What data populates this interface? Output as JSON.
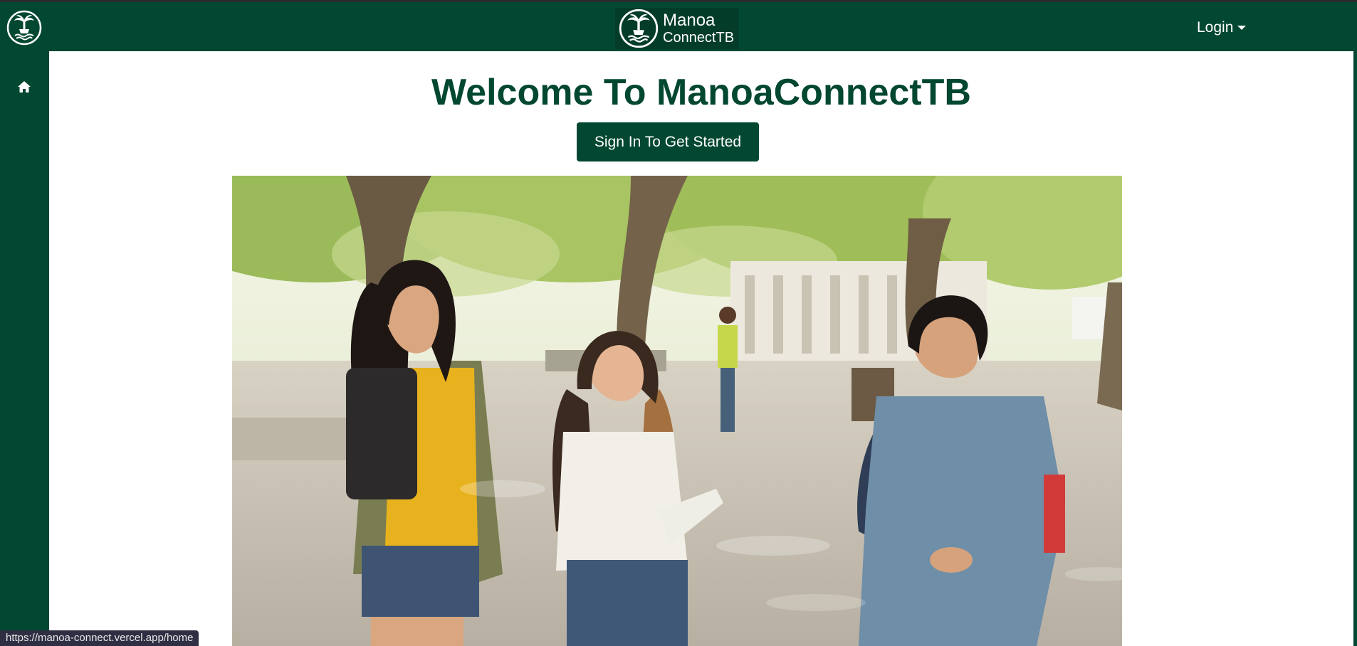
{
  "navbar": {
    "brand_line1": "Manoa",
    "brand_line2": "ConnectTB",
    "login_label": "Login"
  },
  "main": {
    "heading": "Welcome To ManoaConnectTB",
    "cta_label": "Sign In To Get Started"
  },
  "status_bar": {
    "url": "https://manoa-connect.vercel.app/home"
  },
  "colors": {
    "brand_green": "#024731",
    "page_background": "#ffffff",
    "text_on_green": "#ffffff"
  },
  "icons": {
    "corner_logo": "palm-tree-logo-icon",
    "brand_logo": "palm-tree-logo-icon",
    "login_caret": "caret-down-icon",
    "sidebar_home": "home-icon"
  }
}
